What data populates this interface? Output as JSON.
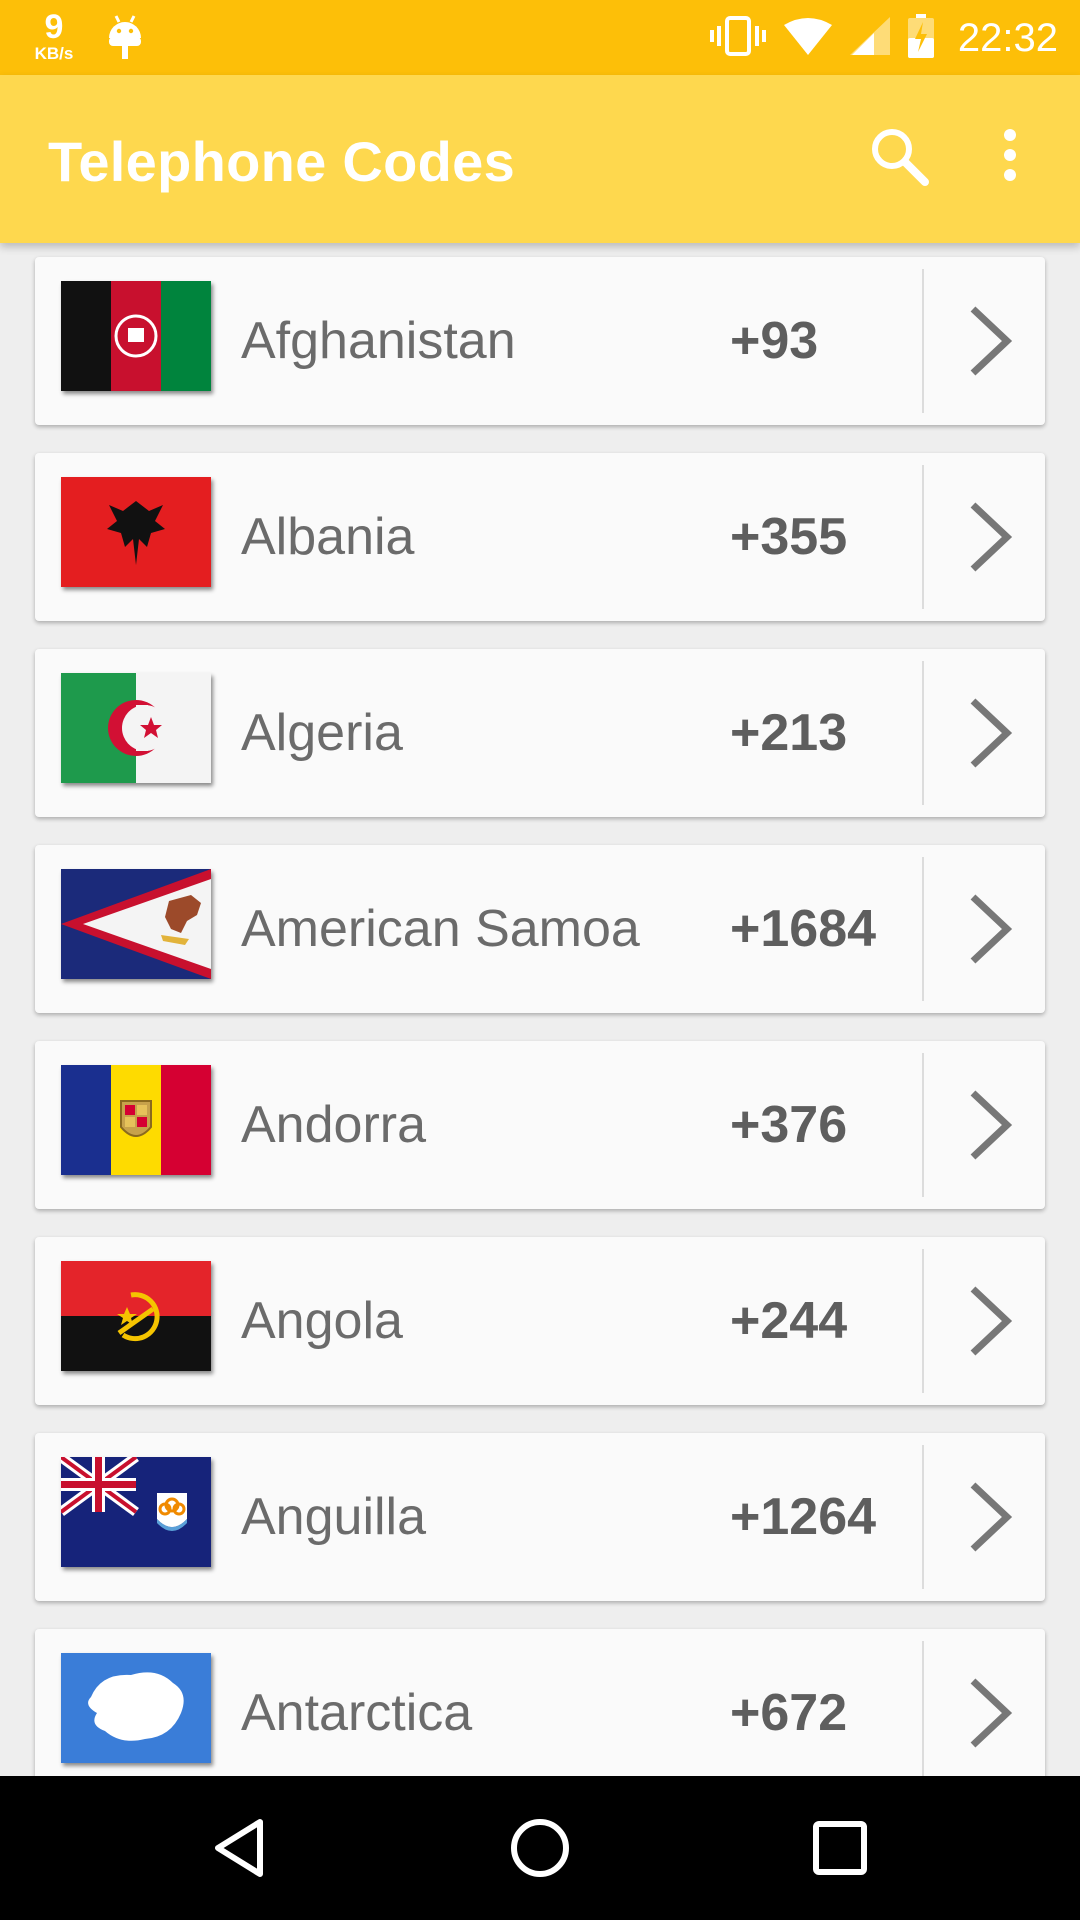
{
  "status_bar": {
    "speed_value": "9",
    "speed_unit": "KB/s",
    "time": "22:32",
    "icons": [
      "android-debug-icon",
      "vibrate-icon",
      "wifi-icon",
      "cell-signal-icon",
      "battery-charging-icon"
    ]
  },
  "app_bar": {
    "title": "Telephone Codes",
    "actions": [
      "search-icon",
      "more-vert-icon"
    ]
  },
  "countries": [
    {
      "name": "Afghanistan",
      "code": "+93",
      "flag": "afghanistan-flag-icon"
    },
    {
      "name": "Albania",
      "code": "+355",
      "flag": "albania-flag-icon"
    },
    {
      "name": "Algeria",
      "code": "+213",
      "flag": "algeria-flag-icon"
    },
    {
      "name": "American Samoa",
      "code": "+1684",
      "flag": "american-samoa-flag-icon"
    },
    {
      "name": "Andorra",
      "code": "+376",
      "flag": "andorra-flag-icon"
    },
    {
      "name": "Angola",
      "code": "+244",
      "flag": "angola-flag-icon"
    },
    {
      "name": "Anguilla",
      "code": "+1264",
      "flag": "anguilla-flag-icon"
    },
    {
      "name": "Antarctica",
      "code": "+672",
      "flag": "antarctica-flag-icon"
    }
  ],
  "nav_bar": {
    "buttons": [
      "back-icon",
      "home-icon",
      "recents-icon"
    ]
  },
  "colors": {
    "status_bar": "#fdbf08",
    "app_bar": "#fed84e",
    "background": "#eeeeee",
    "card": "#fafafa",
    "text": "#6b6b6b"
  }
}
